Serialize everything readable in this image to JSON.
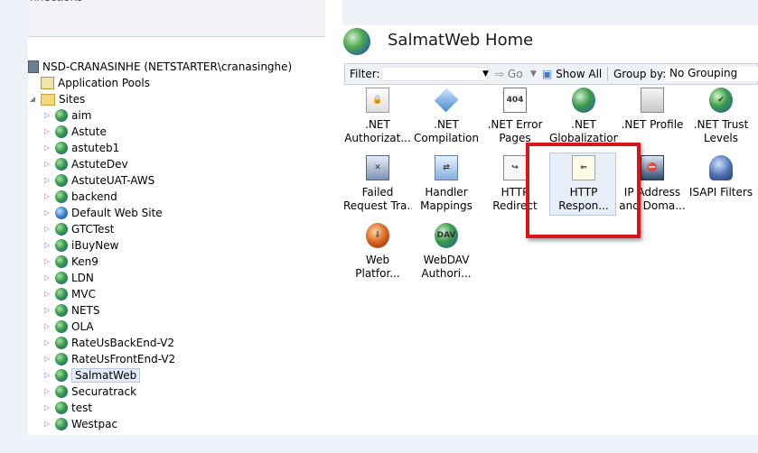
{
  "left_panel": {
    "header_partial": "nnections",
    "tree": {
      "server": "NSD-CRANASINHE (NETSTARTER\\cranasinghe)",
      "app_pools": "Application Pools",
      "sites_label": "Sites",
      "sites": [
        "aim",
        "Astute",
        "astuteb1",
        "AstuteDev",
        "AstuteUAT-AWS",
        "backend",
        "Default Web Site",
        "GTCTest",
        "iBuyNew",
        "Ken9",
        "LDN",
        "MVC",
        "NETS",
        "OLA",
        "RateUsBackEnd-V2",
        "RateUsFrontEnd-V2",
        "SalmatWeb",
        "Securatrack",
        "test",
        "Westpac"
      ],
      "selected": "SalmatWeb"
    }
  },
  "right_panel": {
    "title": "SalmatWeb Home",
    "filter": {
      "label": "Filter:",
      "go": "Go",
      "show_all": "Show All",
      "group_by_label": "Group by:",
      "group_by_value": "No Grouping"
    },
    "features": [
      {
        "line1": ".NET",
        "line2": "Authorizat...",
        "icon": "net-authorization-icon"
      },
      {
        "line1": ".NET",
        "line2": "Compilation",
        "icon": "net-compilation-icon"
      },
      {
        "line1": ".NET Error",
        "line2": "Pages",
        "icon": "net-error-pages-icon"
      },
      {
        "line1": ".NET",
        "line2": "Globalization",
        "icon": "net-globalization-icon"
      },
      {
        "line1": ".NET Profile",
        "line2": "",
        "icon": "net-profile-icon"
      },
      {
        "line1": ".NET Trust",
        "line2": "Levels",
        "icon": "net-trust-levels-icon"
      },
      {
        "line1": "Failed",
        "line2": "Request Tra...",
        "icon": "failed-request-tracing-icon"
      },
      {
        "line1": "Handler",
        "line2": "Mappings",
        "icon": "handler-mappings-icon"
      },
      {
        "line1": "HTTP",
        "line2": "Redirect",
        "icon": "http-redirect-icon"
      },
      {
        "line1": "HTTP",
        "line2": "Respon...",
        "icon": "http-response-headers-icon"
      },
      {
        "line1": "IP Address",
        "line2": "and Doma...",
        "icon": "ip-address-domain-icon"
      },
      {
        "line1": "ISAPI Filters",
        "line2": "",
        "icon": "isapi-filters-icon"
      },
      {
        "line1": "Web",
        "line2": "Platfor...",
        "icon": "web-platform-installer-icon"
      },
      {
        "line1": "WebDAV",
        "line2": "Authori...",
        "icon": "webdav-authoring-icon"
      }
    ],
    "highlighted_feature": "HTTP Respon...",
    "highlight_color": "#d9141b"
  }
}
